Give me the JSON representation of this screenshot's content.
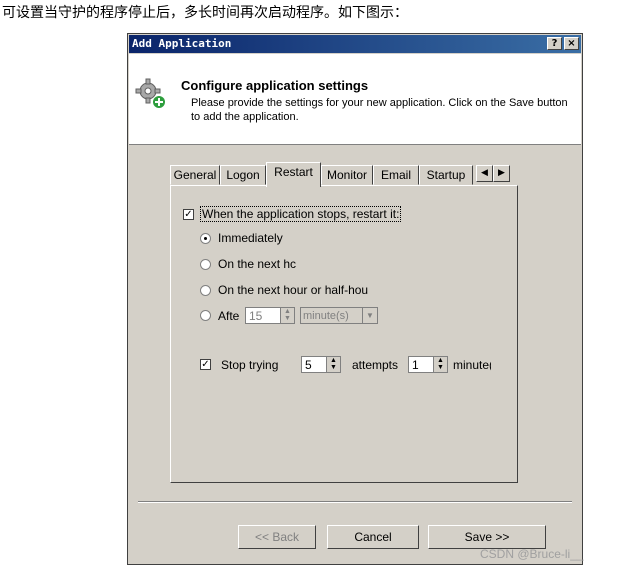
{
  "caption": "可设置当守护的程序停止后，多长时间再次启动程序。如下图示：",
  "dialog": {
    "title": "Add Application",
    "help_label": "?",
    "close_label": "×",
    "header_title": "Configure application settings",
    "header_sub": "Please provide the settings for your new application. Click on the Save button to add the application.",
    "tabs": [
      "General",
      "Logon",
      "Restart",
      "Monitor",
      "Email",
      "Startup"
    ],
    "active_tab": "Restart",
    "scroll_left": "◀",
    "scroll_right": "▶",
    "restart_checkbox_label": "When the application stops, restart it:",
    "options": [
      "Immediately",
      "On the next hc",
      "On the next hour or half-hou",
      "Afte"
    ],
    "after_value": "15",
    "after_unit": "minute(s)",
    "stop_trying_label": "Stop trying",
    "stop_attempts_value": "5",
    "attempts_label": "attempts",
    "minutes_value": "1",
    "minutes_label": "minute(s",
    "buttons": {
      "back": "<< Back",
      "cancel": "Cancel",
      "save": "Save >>"
    }
  },
  "watermark": "CSDN @Bruce-li__"
}
